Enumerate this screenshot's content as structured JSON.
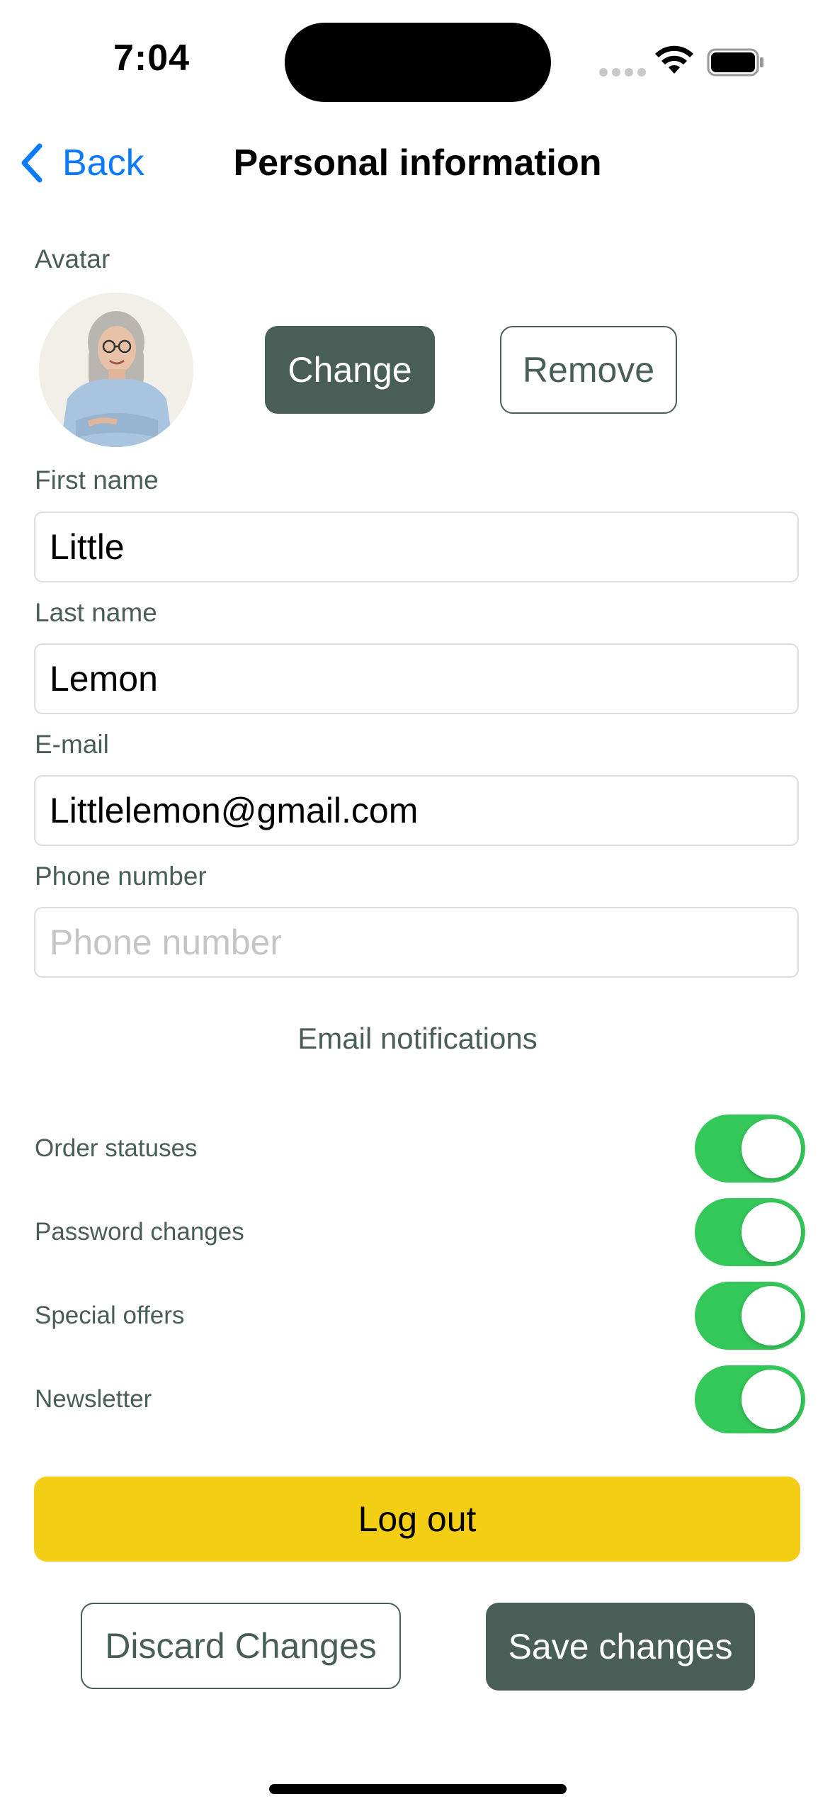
{
  "status_bar": {
    "time": "7:04",
    "icons": [
      "signal-dots-icon",
      "wifi-icon",
      "battery-icon"
    ]
  },
  "nav": {
    "back_label": "Back",
    "back_icon": "chevron-left-icon",
    "title": "Personal information"
  },
  "avatar": {
    "label": "Avatar",
    "change_label": "Change",
    "remove_label": "Remove"
  },
  "form": {
    "first_name": {
      "label": "First name",
      "value": "Little",
      "placeholder": "First name"
    },
    "last_name": {
      "label": "Last name",
      "value": "Lemon",
      "placeholder": "Last name"
    },
    "email": {
      "label": "E-mail",
      "value": "Littlelemon@gmail.com",
      "placeholder": "E-mail"
    },
    "phone": {
      "label": "Phone number",
      "value": "",
      "placeholder": "Phone number"
    }
  },
  "notifications": {
    "heading": "Email notifications",
    "items": [
      {
        "label": "Order statuses",
        "enabled": true
      },
      {
        "label": "Password changes",
        "enabled": true
      },
      {
        "label": "Special offers",
        "enabled": true
      },
      {
        "label": "Newsletter",
        "enabled": true
      }
    ]
  },
  "actions": {
    "logout_label": "Log out",
    "discard_label": "Discard Changes",
    "save_label": "Save changes"
  },
  "colors": {
    "primary_green": "#495e57",
    "accent_yellow": "#f4ce14",
    "toggle_on": "#34c759",
    "link_blue": "#0a7aff"
  }
}
